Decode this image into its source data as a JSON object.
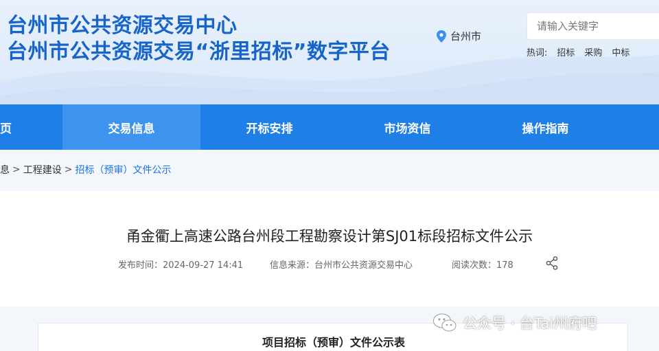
{
  "header": {
    "title_line1": "台州市公共资源交易中心",
    "title_line2": "台州市公共资源交易“浙里招标”数字平台",
    "location": "台州市",
    "search_placeholder": "请输入关键字",
    "hot_label": "热词:",
    "hot_words": [
      "招标",
      "采购",
      "中标"
    ]
  },
  "nav": {
    "items": [
      {
        "label": "页"
      },
      {
        "label": "交易信息",
        "active": true
      },
      {
        "label": "开标安排"
      },
      {
        "label": "市场资信"
      },
      {
        "label": "操作指南"
      }
    ]
  },
  "breadcrumb": {
    "items": [
      "息",
      "工程建设",
      "招标（预审）文件公示"
    ],
    "separator": ">"
  },
  "article": {
    "title": "甬金衢上高速公路台州段工程勘察设计第SJ01标段招标文件公示",
    "publish_time": "发布时间：2024-09-27 14:41",
    "source": "信息来源：台州市公共资源交易中心",
    "views": "阅读次数：178"
  },
  "table": {
    "title": "项目招标（预审）文件公示表"
  },
  "watermark": {
    "text": "公众号 · 台Tai州府吧"
  },
  "colors": {
    "brand_blue": "#1865c9",
    "nav_blue": "#1e7fe6",
    "nav_active": "#3d93ee",
    "link_blue": "#1a73e8"
  }
}
